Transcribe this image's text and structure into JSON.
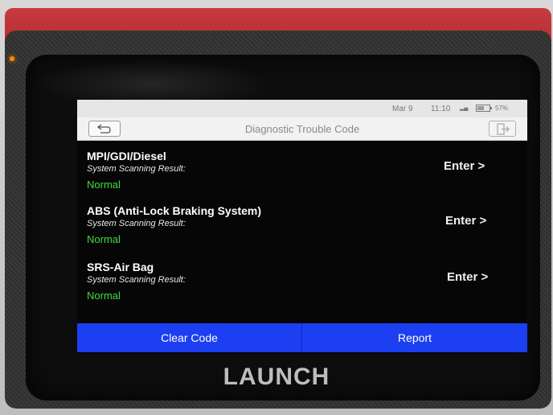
{
  "status_bar": {
    "date": "Mar 9",
    "time": "11:10",
    "battery_percent": "57%",
    "battery_level": 0.57
  },
  "header": {
    "title": "Diagnostic Trouble Code",
    "back_icon": "back-arrow-icon",
    "exit_icon": "exit-icon"
  },
  "systems": [
    {
      "name": "MPI/GDI/Diesel",
      "result_label": "System Scanning Result:",
      "result": "Normal",
      "action": "Enter >"
    },
    {
      "name": "ABS (Anti-Lock Braking System)",
      "result_label": "System Scanning Result:",
      "result": "Normal",
      "action": "Enter >"
    },
    {
      "name": "SRS-Air Bag",
      "result_label": "System Scanning Result:",
      "result": "Normal",
      "action": "Enter >"
    }
  ],
  "footer": {
    "clear_label": "Clear Code",
    "report_label": "Report"
  },
  "device": {
    "brand": "LAUNCH"
  },
  "colors": {
    "accent_blue": "#1c3ff2",
    "status_normal": "#3fdc3f",
    "housing_red": "#c63b3f"
  }
}
